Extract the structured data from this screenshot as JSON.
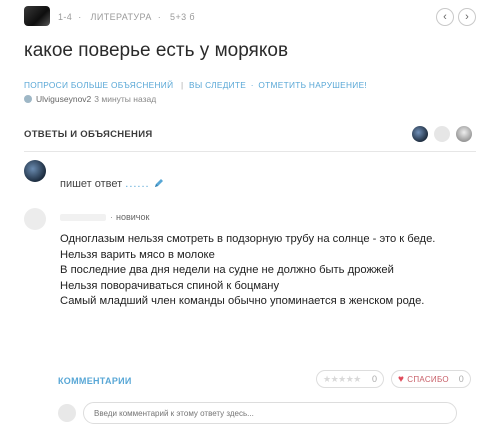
{
  "header": {
    "meta": {
      "grade": "1-4",
      "subject": "ЛИТЕРАТУРА",
      "points": "5+3 б"
    },
    "prev_glyph": "‹",
    "next_glyph": "›"
  },
  "question": {
    "title": "какое поверье есть у моряков",
    "links": {
      "ask_more": "ПОПРОСИ БОЛЬШЕ ОБЪЯСНЕНИЙ",
      "follow": "ВЫ СЛЕДИТЕ",
      "report": "ОТМЕТИТЬ НАРУШЕНИЕ!"
    },
    "asker": {
      "name": "Ulviguseynov2",
      "time": "3 минуты назад"
    }
  },
  "answers_section": {
    "title": "ОТВЕТЫ И ОБЪЯСНЕНИЯ"
  },
  "answering": {
    "text": "пишет ответ",
    "dots": "......"
  },
  "answer": {
    "rank": "новичок",
    "lines": [
      "Одноглазым нельзя смотреть в подзорную трубу на солнце - это к беде.",
      "Нельзя варить мясо в молоке",
      "В последние два дня недели на судне не должно быть дрожжей",
      "Нельзя поворачиваться спиной к боцману",
      "Самый младший член команды обычно упоминается в женском роде."
    ],
    "comments_label": "КОММЕНТАРИИ",
    "rating": {
      "stars": "★★★★★",
      "count": "0"
    },
    "thanks": {
      "label": "СПАСИБО",
      "count": "0"
    },
    "comment_placeholder": "Введи комментарий к этому ответу здесь..."
  },
  "colors": {
    "link": "#58a7d6",
    "heart": "#e04a5a"
  }
}
